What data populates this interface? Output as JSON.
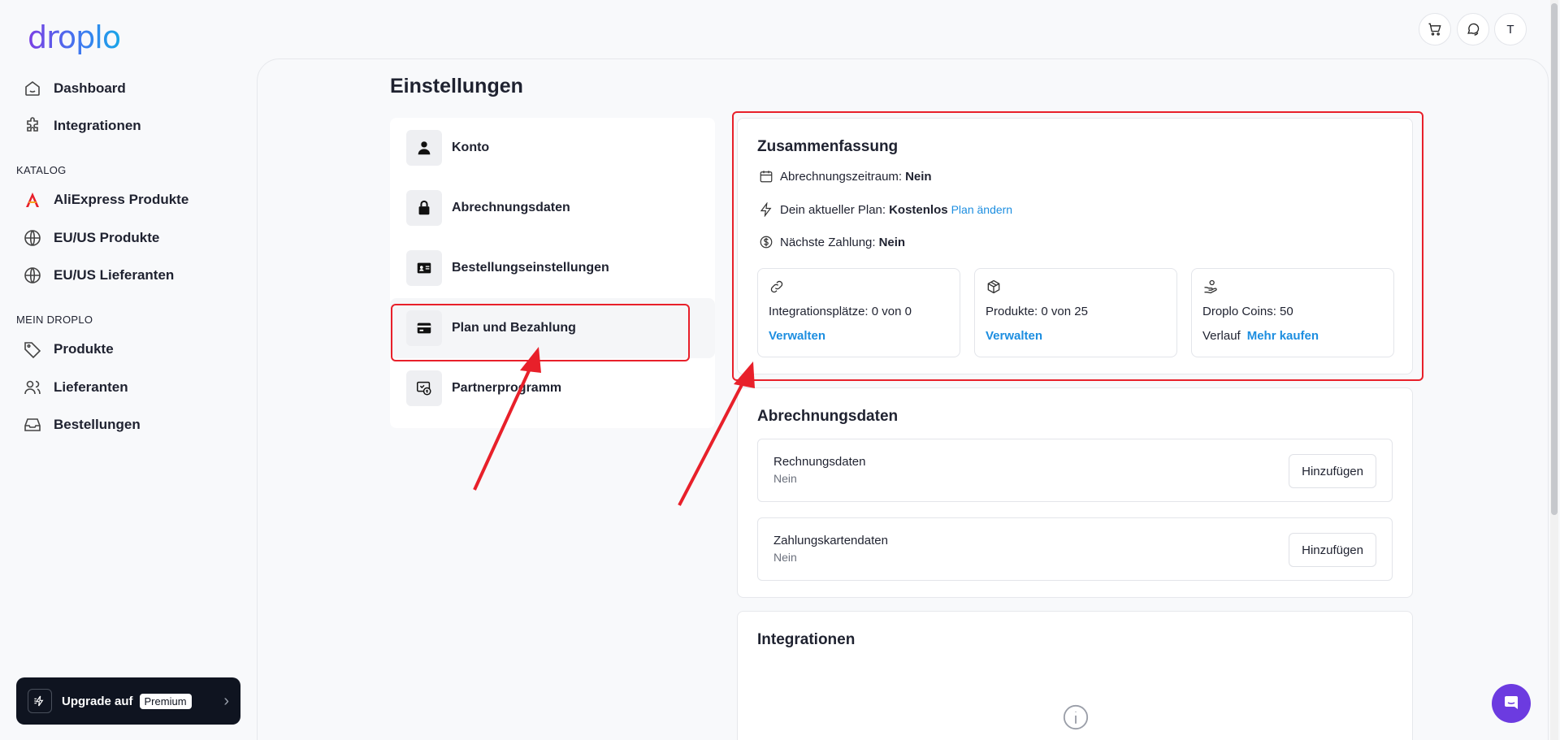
{
  "brand": {
    "logo_text": "droplo"
  },
  "sidebar": {
    "items_top": [
      {
        "label": "Dashboard",
        "icon": "home-icon"
      },
      {
        "label": "Integrationen",
        "icon": "puzzle-icon"
      }
    ],
    "section_catalog": "KATALOG",
    "items_catalog": [
      {
        "label": "AliExpress Produkte",
        "icon": "aliexpress-icon"
      },
      {
        "label": "EU/US Produkte",
        "icon": "globe-icon"
      },
      {
        "label": "EU/US Lieferanten",
        "icon": "globe-icon"
      }
    ],
    "section_mine": "MEIN DROPLO",
    "items_mine": [
      {
        "label": "Produkte",
        "icon": "tag-icon"
      },
      {
        "label": "Lieferanten",
        "icon": "users-icon"
      },
      {
        "label": "Bestellungen",
        "icon": "inbox-icon"
      }
    ],
    "upgrade": {
      "label": "Upgrade auf",
      "badge": "Premium"
    }
  },
  "header": {
    "avatar_letter": "T"
  },
  "page": {
    "title": "Einstellungen"
  },
  "settings_menu": {
    "items": [
      {
        "label": "Konto",
        "icon": "user-icon"
      },
      {
        "label": "Abrechnungsdaten",
        "icon": "lock-icon"
      },
      {
        "label": "Bestellungseinstellungen",
        "icon": "id-card-icon"
      },
      {
        "label": "Plan und Bezahlung",
        "icon": "credit-card-icon"
      },
      {
        "label": "Partnerprogramm",
        "icon": "partner-icon"
      }
    ]
  },
  "summary": {
    "title": "Zusammenfassung",
    "billing_period_label": "Abrechnungszeitraum:",
    "billing_period_value": "Nein",
    "plan_label": "Dein aktueller Plan:",
    "plan_value": "Kostenlos",
    "plan_change": "Plan ändern",
    "next_payment_label": "Nächste Zahlung:",
    "next_payment_value": "Nein",
    "cards": [
      {
        "text": "Integrationsplätze: 0 von 0",
        "link": "Verwalten",
        "icon": "link-icon"
      },
      {
        "text": "Produkte: 0 von 25",
        "link": "Verwalten",
        "icon": "box-icon"
      },
      {
        "text": "Droplo Coins: 50",
        "plain": "Verlauf",
        "link": "Mehr kaufen",
        "icon": "coins-hand-icon"
      }
    ]
  },
  "billing": {
    "title": "Abrechnungsdaten",
    "rows": [
      {
        "title": "Rechnungsdaten",
        "value": "Nein",
        "button": "Hinzufügen"
      },
      {
        "title": "Zahlungskartendaten",
        "value": "Nein",
        "button": "Hinzufügen"
      }
    ]
  },
  "integrations": {
    "title": "Integrationen"
  },
  "colors": {
    "accent": "#1d8ee0",
    "highlight": "#e8202a",
    "chat": "#6c3be0"
  }
}
